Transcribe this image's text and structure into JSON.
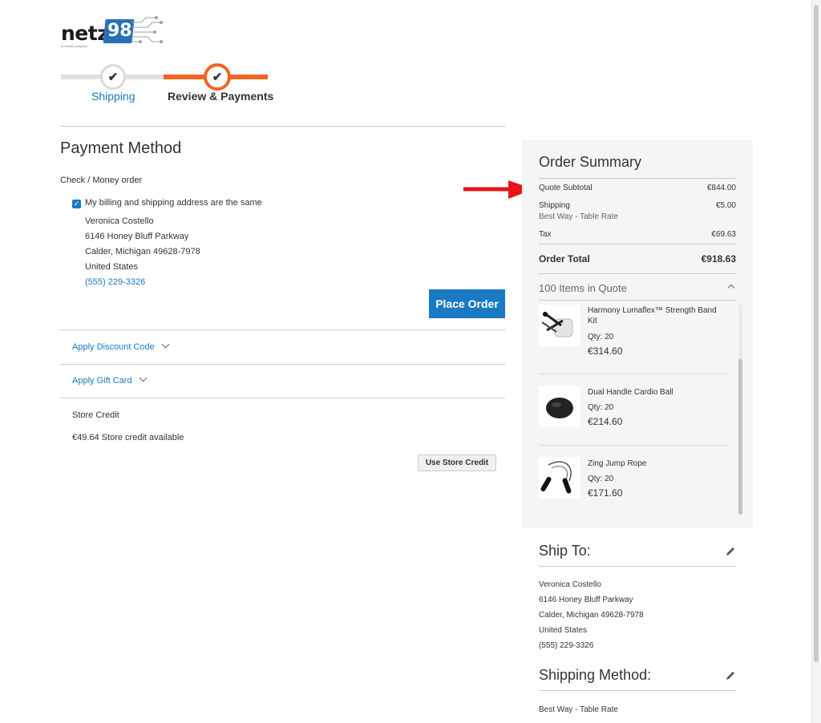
{
  "logo": {
    "text": "netz",
    "number": "98",
    "tagline": "a netz98 company"
  },
  "progress": {
    "steps": [
      {
        "label": "Shipping",
        "state": "complete"
      },
      {
        "label": "Review & Payments",
        "state": "active"
      }
    ]
  },
  "payment": {
    "title": "Payment Method",
    "method": "Check / Money order",
    "same_address_label": "My billing and shipping address are the same",
    "same_address_checked": true,
    "billing": {
      "name": "Veronica Costello",
      "street": "6146 Honey Bluff Parkway",
      "city": "Calder, Michigan 49628-7978",
      "country": "United States",
      "phone": "(555) 229-3326"
    },
    "place_order": "Place Order",
    "discount_label": "Apply Discount Code",
    "giftcard_label": "Apply Gift Card",
    "store_credit_title": "Store Credit",
    "store_credit_available": "€49.64 Store credit available",
    "use_store_credit": "Use Store Credit"
  },
  "summary": {
    "title": "Order Summary",
    "subtotal_label": "Quote Subtotal",
    "subtotal_value": "€844.00",
    "shipping_label": "Shipping",
    "shipping_method": "Best Way - Table Rate",
    "shipping_value": "€5.00",
    "tax_label": "Tax",
    "tax_value": "€69.63",
    "total_label": "Order Total",
    "total_value": "€918.63",
    "items_count": "100 Items in Quote",
    "items": [
      {
        "name": "Harmony Lumaflex™ Strength Band Kit",
        "qty": "Qty: 20",
        "price": "€314.60"
      },
      {
        "name": "Dual Handle Cardio Ball",
        "qty": "Qty: 20",
        "price": "€214.60"
      },
      {
        "name": "Zing Jump Rope",
        "qty": "Qty: 20",
        "price": "€171.60"
      }
    ]
  },
  "ship_to": {
    "title": "Ship To:",
    "name": "Veronica Costello",
    "street": "6146 Honey Bluff Parkway",
    "city": "Calder, Michigan 49628-7978",
    "country": "United States",
    "phone": "(555) 229-3326"
  },
  "shipping_method": {
    "title": "Shipping Method:",
    "value": "Best Way - Table Rate"
  },
  "colors": {
    "accent": "#1979c3",
    "progress": "#f26322",
    "annotation_arrow": "#e8141a"
  }
}
